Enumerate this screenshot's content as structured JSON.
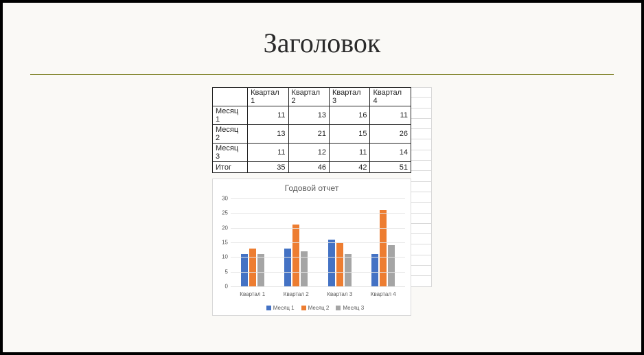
{
  "title": "Заголовок",
  "table": {
    "col_h": [
      "Квартал 1",
      "Квартал 2",
      "Квартал 3",
      "Квартал 4"
    ],
    "rows": [
      {
        "label": "Месяц 1",
        "v": [
          11,
          13,
          16,
          11
        ]
      },
      {
        "label": "Месяц 2",
        "v": [
          13,
          21,
          15,
          26
        ]
      },
      {
        "label": "Месяц 3",
        "v": [
          11,
          12,
          11,
          14
        ]
      },
      {
        "label": "Итог",
        "v": [
          35,
          46,
          42,
          51
        ]
      }
    ]
  },
  "chart_data": {
    "type": "bar",
    "title": "Годовой отчет",
    "categories": [
      "Квартал 1",
      "Квартал 2",
      "Квартал 3",
      "Квартал 4"
    ],
    "series": [
      {
        "name": "Месяц 1",
        "values": [
          11,
          13,
          16,
          11
        ],
        "color": "#4472c4"
      },
      {
        "name": "Месяц 2",
        "values": [
          13,
          21,
          15,
          26
        ],
        "color": "#ed7d31"
      },
      {
        "name": "Месяц 3",
        "values": [
          11,
          12,
          11,
          14
        ],
        "color": "#a5a5a5"
      }
    ],
    "xlabel": "",
    "ylabel": "",
    "ylim": [
      0,
      30
    ],
    "y_ticks": [
      0,
      5,
      10,
      15,
      20,
      25,
      30
    ],
    "grid": true,
    "legend_position": "bottom"
  }
}
